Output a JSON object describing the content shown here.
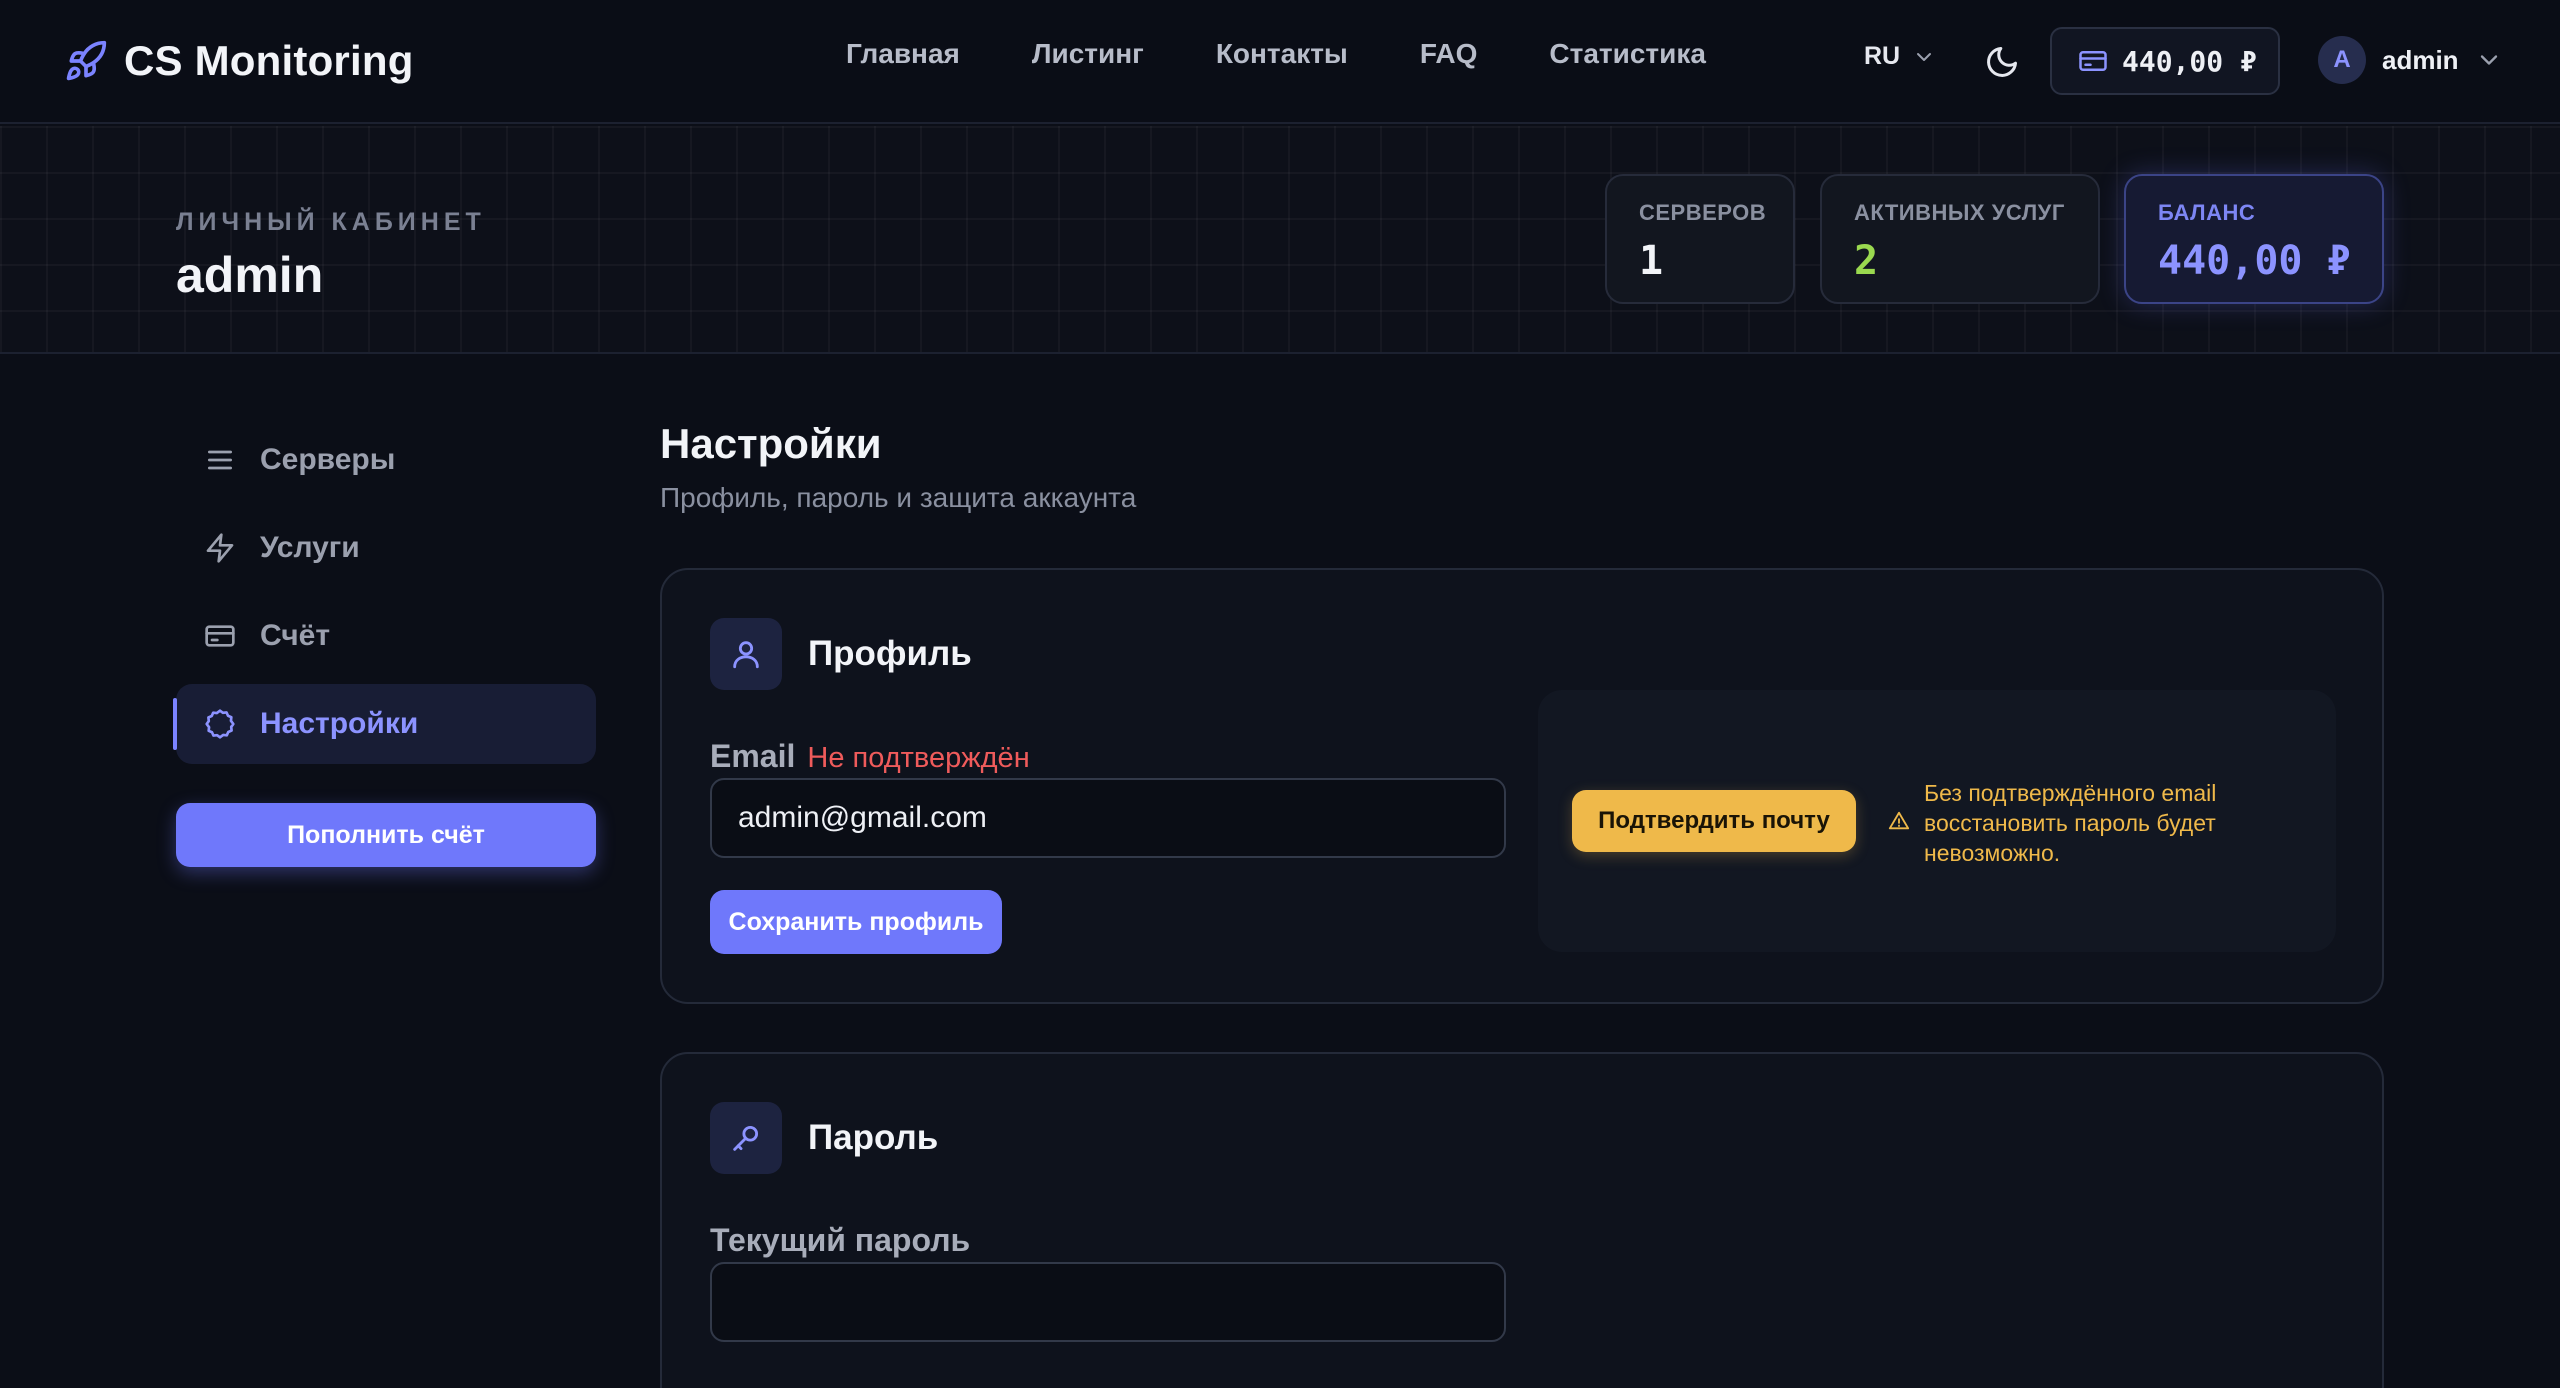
{
  "header": {
    "logo_text": "CS Monitoring",
    "nav": [
      "Главная",
      "Листинг",
      "Контакты",
      "FAQ",
      "Статистика"
    ],
    "lang": "RU",
    "wallet_balance": "440,00 ₽",
    "avatar_letter": "A",
    "user_name": "admin"
  },
  "banner": {
    "label": "ЛИЧНЫЙ КАБИНЕТ",
    "username": "admin",
    "stats": [
      {
        "label": "СЕРВЕРОВ",
        "value": "1"
      },
      {
        "label": "АКТИВНЫХ УСЛУГ",
        "value": "2"
      },
      {
        "label": "БАЛАНС",
        "value": "440,00 ₽"
      }
    ]
  },
  "sidebar": {
    "items": [
      {
        "label": "Серверы",
        "icon": "list-icon"
      },
      {
        "label": "Услуги",
        "icon": "lightning-icon"
      },
      {
        "label": "Счёт",
        "icon": "credit-card-icon"
      },
      {
        "label": "Настройки",
        "icon": "settings-icon",
        "active": true
      }
    ],
    "topup_label": "Пополнить счёт"
  },
  "main": {
    "title": "Настройки",
    "subtitle": "Профиль, пароль и защита аккаунта",
    "profile": {
      "title": "Профиль",
      "email_label": "Email",
      "email_status": "Не подтверждён",
      "email_value": "admin@gmail.com",
      "save_label": "Сохранить профиль",
      "verify_label": "Подтвердить почту",
      "warning": "Без подтверждённого email восстановить пароль будет невозможно."
    },
    "password": {
      "title": "Пароль",
      "current_label": "Текущий пароль",
      "current_value": ""
    }
  },
  "colors": {
    "accent": "#6f78fb",
    "warning": "#efb94a",
    "error": "#ef5b5b",
    "success": "#9ad94f",
    "background": "#0b0e17"
  }
}
